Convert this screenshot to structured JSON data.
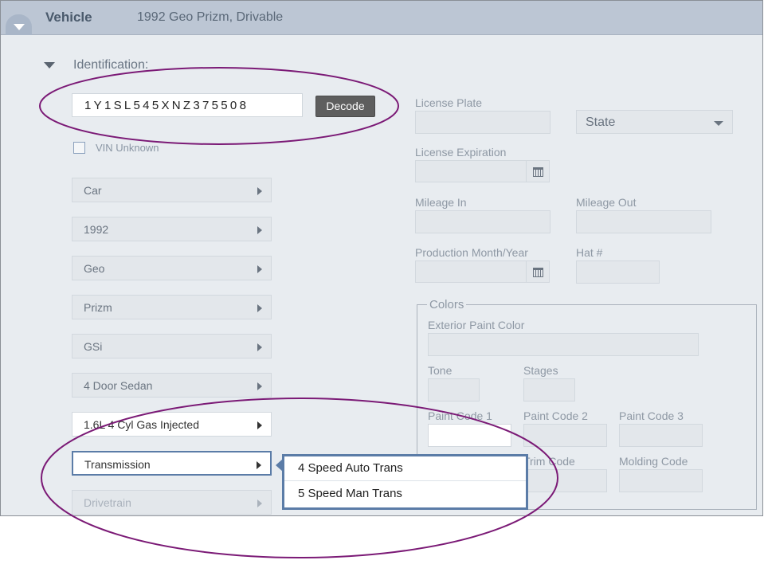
{
  "header": {
    "title": "Vehicle",
    "vehicle_summary": "1992 Geo Prizm, Drivable"
  },
  "identification": {
    "section_title": "Identification:",
    "vin": "1Y1SL545XNZ375508",
    "decode_label": "Decode",
    "vin_unknown_label": "VIN Unknown",
    "selectors": [
      "Car",
      "1992",
      "Geo",
      "Prizm",
      "GSi",
      "4 Door Sedan",
      "1.6L 4 Cyl Gas Injected",
      "Transmission",
      "Drivetrain"
    ]
  },
  "fields": {
    "license_plate": "License Plate",
    "state": "State",
    "license_expiration": "License Expiration",
    "mileage_in": "Mileage In",
    "mileage_out": "Mileage Out",
    "production": "Production Month/Year",
    "hat": "Hat #"
  },
  "colors": {
    "legend": "Colors",
    "exterior": "Exterior Paint Color",
    "tone": "Tone",
    "stages": "Stages",
    "paint_code_1": "Paint Code 1",
    "paint_code_2": "Paint Code 2",
    "paint_code_3": "Paint Code 3",
    "trim_code": "Trim Code",
    "molding_code": "Molding Code"
  },
  "transmission_options": [
    "4 Speed Auto Trans",
    "5 Speed Man Trans"
  ],
  "annotation_color": "#7b1a76"
}
